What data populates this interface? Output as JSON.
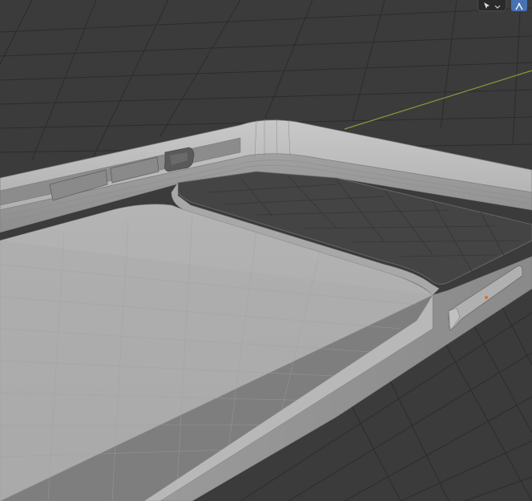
{
  "app": {
    "view": "3d-viewport",
    "mode": "solid-shading"
  },
  "header": {
    "select_tool_icon": "cursor-arrow-icon",
    "dropdown_icon": "chevron-down-icon",
    "gizmo_icon": "transform-gizmo-icon"
  },
  "scene": {
    "object": "phone-case-mesh",
    "grid_visible": true,
    "x_axis_color": "#8a9a3a",
    "origin_marker_color": "#d9702a",
    "background_color": "#3b3b3b",
    "mesh_color": "#9c9c9c"
  }
}
